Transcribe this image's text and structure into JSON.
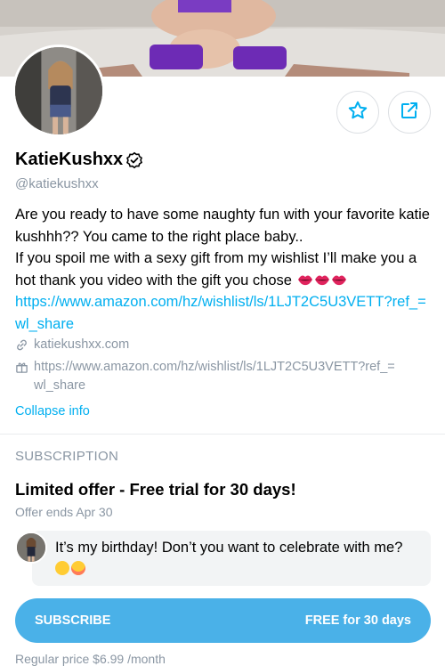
{
  "profile": {
    "name": "KatieKushxx",
    "handle": "@katiekushxx",
    "bio_lines": [
      "Are you ready to have some naughty fun with your favorite katie kushhh?? You came to the right place baby..",
      "If you spoil me with a sexy gift from my wishlist I’ll make you a hot thank you video with the gift you chose"
    ],
    "bio_link": "https://www.amazon.com/hz/wishlist/ls/1LJT2C5U3VETT?ref_=wl_share",
    "website": "katiekushxx.com",
    "wishlist": "https://www.amazon.com/hz/wishlist/ls/1LJT2C5U3VETT?ref_=wl_share",
    "collapse_label": "Collapse info"
  },
  "icons": {
    "favorite": "star-icon",
    "share": "share-icon",
    "verified": "verified-badge-icon",
    "link": "link-icon",
    "gift": "gift-icon"
  },
  "subscription": {
    "section_title": "SUBSCRIPTION",
    "offer_title": "Limited offer - Free trial for 30 days!",
    "offer_ends": "Offer ends Apr 30",
    "message": "It’s my birthday! Don’t you want to celebrate with me?",
    "button_label": "SUBSCRIBE",
    "button_price": "FREE for 30 days",
    "regular_price": "Regular price $6.99 /month"
  },
  "colors": {
    "accent": "#00aff0",
    "button": "#4ab1e8",
    "muted": "#8a96a3"
  }
}
